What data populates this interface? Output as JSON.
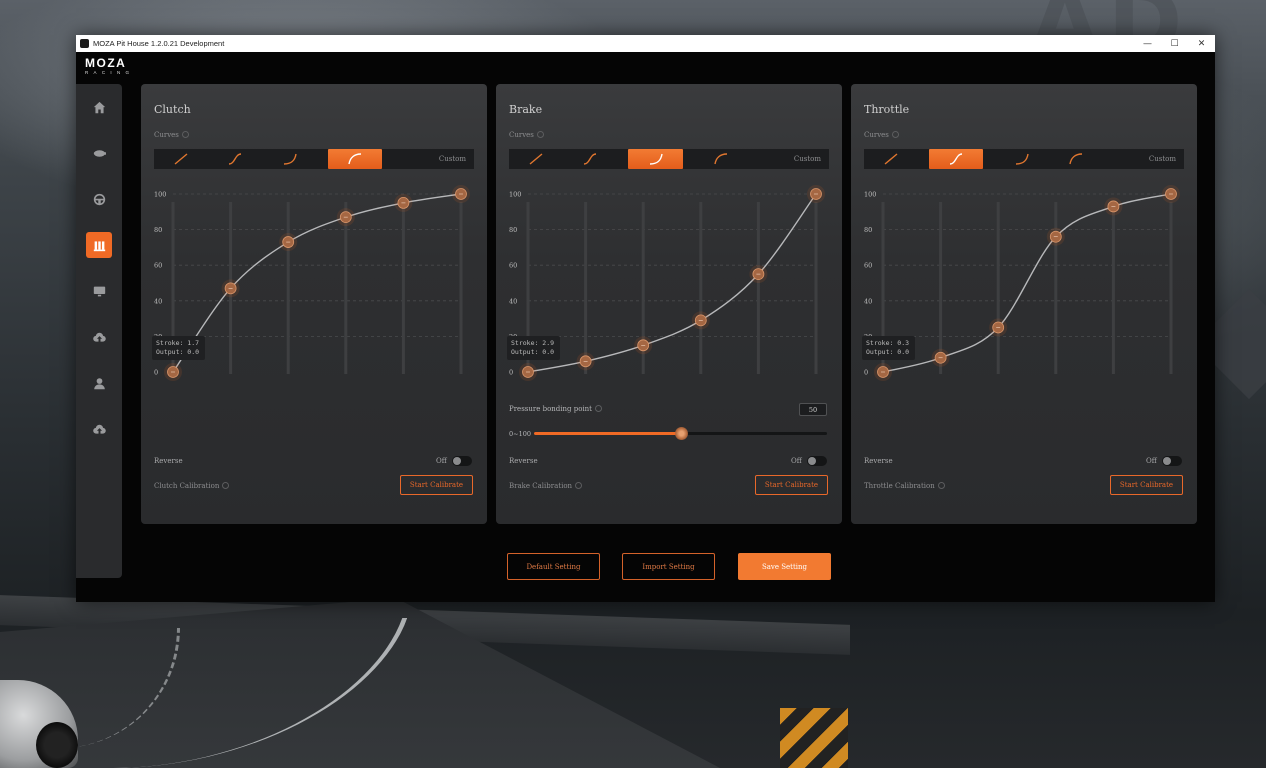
{
  "window": {
    "title": "MOZA Pit House 1.2.0.21 Development",
    "controls": [
      "—",
      "☐",
      "✕"
    ]
  },
  "brand": {
    "name": "MOZA",
    "sub": "RACING"
  },
  "sidebar": {
    "items": [
      {
        "name": "home",
        "active": false
      },
      {
        "name": "motor",
        "active": false
      },
      {
        "name": "steering-wheel",
        "active": false
      },
      {
        "name": "pedals",
        "active": true
      },
      {
        "name": "dashboard",
        "active": false
      },
      {
        "name": "cloud-upload",
        "active": false
      },
      {
        "name": "user",
        "active": false
      },
      {
        "name": "firmware-upload",
        "active": false
      }
    ]
  },
  "chart_data": [
    {
      "type": "line",
      "title": "Clutch",
      "yticks": [
        0,
        20,
        40,
        60,
        80,
        100
      ],
      "ylim": [
        0,
        100
      ],
      "x": [
        0,
        20,
        40,
        60,
        80,
        100
      ],
      "values": [
        0,
        47,
        73,
        87,
        95,
        100
      ],
      "grid": true
    },
    {
      "type": "line",
      "title": "Brake",
      "yticks": [
        0,
        20,
        40,
        60,
        80,
        100
      ],
      "ylim": [
        0,
        100
      ],
      "x": [
        0,
        20,
        40,
        60,
        80,
        100
      ],
      "values": [
        0,
        6,
        15,
        29,
        55,
        100
      ],
      "grid": true
    },
    {
      "type": "line",
      "title": "Throttle",
      "yticks": [
        0,
        20,
        40,
        60,
        80,
        100
      ],
      "ylim": [
        0,
        100
      ],
      "x": [
        0,
        20,
        40,
        60,
        80,
        100
      ],
      "values": [
        0,
        8,
        25,
        76,
        93,
        100
      ],
      "grid": true
    }
  ],
  "panels": [
    {
      "title": "Clutch",
      "curves_label": "Curves",
      "active_curve": 3,
      "custom_label": "Custom",
      "tooltip": {
        "stroke": "Stroke: 1.7",
        "output": "Output: 0.0"
      },
      "reverse_label": "Reverse",
      "reverse_state": "Off",
      "calibration_label": "Clutch Calibration",
      "calibration_button": "Start Calibrate"
    },
    {
      "title": "Brake",
      "curves_label": "Curves",
      "active_curve": 2,
      "custom_label": "Custom",
      "tooltip": {
        "stroke": "Stroke: 2.9",
        "output": "Output: 0.0"
      },
      "pressure_label": "Pressure bonding point",
      "pressure_value": "50",
      "pressure_fraction": 0.5,
      "range_label": "0~100",
      "reverse_label": "Reverse",
      "reverse_state": "Off",
      "calibration_label": "Brake Calibration",
      "calibration_button": "Start Calibrate"
    },
    {
      "title": "Throttle",
      "curves_label": "Curves",
      "active_curve": 1,
      "custom_label": "Custom",
      "tooltip": {
        "stroke": "Stroke: 0.3",
        "output": "Output: 0.0"
      },
      "reverse_label": "Reverse",
      "reverse_state": "Off",
      "calibration_label": "Throttle Calibration",
      "calibration_button": "Start Calibrate"
    }
  ],
  "footer": {
    "default_setting": "Default Setting",
    "import_setting": "Import Setting",
    "save_setting": "Save Setting"
  },
  "colors": {
    "accent": "#f06a25",
    "panel": "#2e2f31",
    "window_bg": "#050505"
  }
}
